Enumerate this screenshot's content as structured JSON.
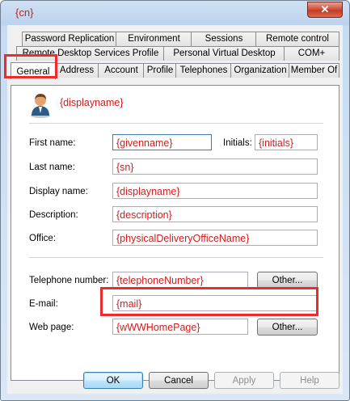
{
  "window": {
    "title": "{cn}",
    "close_label": "✕"
  },
  "tabs": {
    "row1": [
      "Password Replication",
      "Environment",
      "Sessions",
      "Remote control"
    ],
    "row2": [
      "Remote Desktop Services Profile",
      "Personal Virtual Desktop",
      "COM+"
    ],
    "row3": [
      "General",
      "Address",
      "Account",
      "Profile",
      "Telephones",
      "Organization",
      "Member Of"
    ]
  },
  "header": {
    "display_name": "{displayname}"
  },
  "labels": {
    "first_name": "First name:",
    "initials": "Initials:",
    "last_name": "Last name:",
    "display_name": "Display name:",
    "description": "Description:",
    "office": "Office:",
    "telephone": "Telephone number:",
    "email": "E-mail:",
    "web_page": "Web page:"
  },
  "values": {
    "first_name": "{givenname}",
    "initials": "{initials}",
    "last_name": "{sn}",
    "display_name": "{displayname}",
    "description": "{description}",
    "office": "{physicalDeliveryOfficeName}",
    "telephone": "{telephoneNumber}",
    "email": "{mail}",
    "web_page": "{wWWHomePage}"
  },
  "buttons": {
    "other_phone": "Other...",
    "other_web": "Other...",
    "ok": "OK",
    "cancel": "Cancel",
    "apply": "Apply",
    "help": "Help"
  },
  "icons": {
    "user": "user-icon"
  },
  "colors": {
    "highlight": "#ee2b2b",
    "placeholder_text": "#d01d1d"
  }
}
